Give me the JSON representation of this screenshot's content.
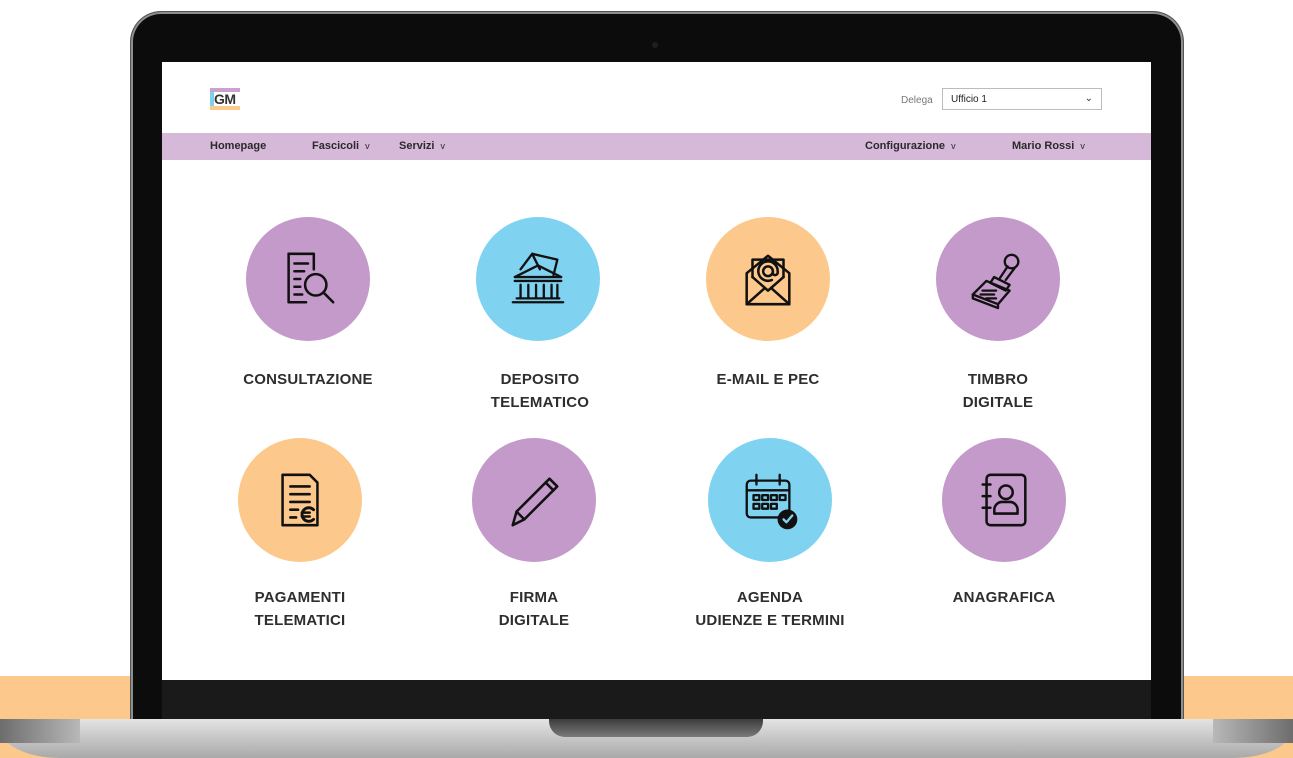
{
  "header": {
    "logo_text": "GM",
    "delega_label": "Delega",
    "delega_selected": "Ufficio 1"
  },
  "nav": {
    "left": [
      "Homepage",
      "Fascicoli",
      "Servizi"
    ],
    "right": [
      "Configurazione",
      "Mario Rossi"
    ],
    "caret": "v"
  },
  "tiles": [
    {
      "line1": "CONSULTAZIONE",
      "line2": "",
      "icon": "document-search-icon",
      "color": "#c39ac9"
    },
    {
      "line1": "DEPOSITO",
      "line2": "TELEMATICO",
      "icon": "courthouse-mail-icon",
      "color": "#7fd3f1"
    },
    {
      "line1": "E-MAIL E PEC",
      "line2": "",
      "icon": "email-at-icon",
      "color": "#fcc88c"
    },
    {
      "line1": "TIMBRO",
      "line2": "DIGITALE",
      "icon": "stamp-icon",
      "color": "#c39ac9"
    },
    {
      "line1": "PAGAMENTI",
      "line2": "TELEMATICI",
      "icon": "invoice-euro-icon",
      "color": "#fcc88c"
    },
    {
      "line1": "FIRMA",
      "line2": "DIGITALE",
      "icon": "pencil-icon",
      "color": "#c39ac9"
    },
    {
      "line1": "AGENDA",
      "line2": "UDIENZE E TERMINI",
      "icon": "calendar-check-icon",
      "color": "#7fd3f1"
    },
    {
      "line1": "ANAGRAFICA",
      "line2": "",
      "icon": "contact-book-icon",
      "color": "#c39ac9"
    }
  ]
}
